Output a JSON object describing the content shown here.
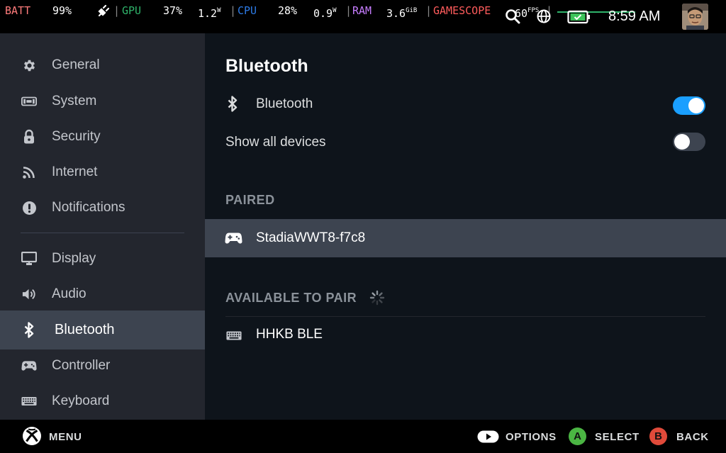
{
  "overlay": {
    "batt_label": "BATT",
    "batt_value": "99%",
    "gpu_label": "GPU",
    "gpu_load": "37%",
    "gpu_power": "1.2",
    "gpu_power_unit": "W",
    "cpu_label": "CPU",
    "cpu_load": "28%",
    "cpu_power": "0.9",
    "cpu_power_unit": "W",
    "ram_label": "RAM",
    "ram_value": "3.6",
    "ram_unit": "GiB",
    "gamescope_label": "GAMESCOPE",
    "fps_value": "60",
    "fps_unit": "FPS",
    "separator": "|"
  },
  "status": {
    "time": "8:59 AM",
    "battery_level": 0.99,
    "icons": [
      "search-icon",
      "globe-icon",
      "battery-icon"
    ]
  },
  "sidebar": {
    "items": [
      {
        "label": "General",
        "icon": "gear-icon"
      },
      {
        "label": "System",
        "icon": "system-icon"
      },
      {
        "label": "Security",
        "icon": "lock-icon"
      },
      {
        "label": "Internet",
        "icon": "wifi-icon"
      },
      {
        "label": "Notifications",
        "icon": "alert-icon"
      },
      {
        "label": "Display",
        "icon": "monitor-icon"
      },
      {
        "label": "Audio",
        "icon": "speaker-icon"
      },
      {
        "label": "Bluetooth",
        "icon": "bluetooth-icon"
      },
      {
        "label": "Controller",
        "icon": "gamepad-icon"
      },
      {
        "label": "Keyboard",
        "icon": "keyboard-icon"
      }
    ],
    "active": "Bluetooth"
  },
  "main": {
    "title": "Bluetooth",
    "bluetooth_toggle": {
      "label": "Bluetooth",
      "on": true
    },
    "show_all_toggle": {
      "label": "Show all devices",
      "on": false
    },
    "paired_header": "PAIRED",
    "paired_devices": [
      {
        "name": "StadiaWWT8-f7c8",
        "icon": "gamepad-icon"
      }
    ],
    "available_header": "AVAILABLE TO PAIR",
    "available_devices": [
      {
        "name": "HHKB BLE",
        "icon": "keyboard-icon"
      }
    ]
  },
  "footer": {
    "menu_label": "MENU",
    "options_label": "OPTIONS",
    "select_button": "A",
    "select_label": "SELECT",
    "back_button": "B",
    "back_label": "BACK"
  },
  "colors": {
    "accent": "#1a9fff",
    "sidebar_bg": "#23262e",
    "main_bg": "#0e141b",
    "selected_bg": "#3d4450",
    "select_button": "#4bb543",
    "back_button": "#e04a3a"
  }
}
